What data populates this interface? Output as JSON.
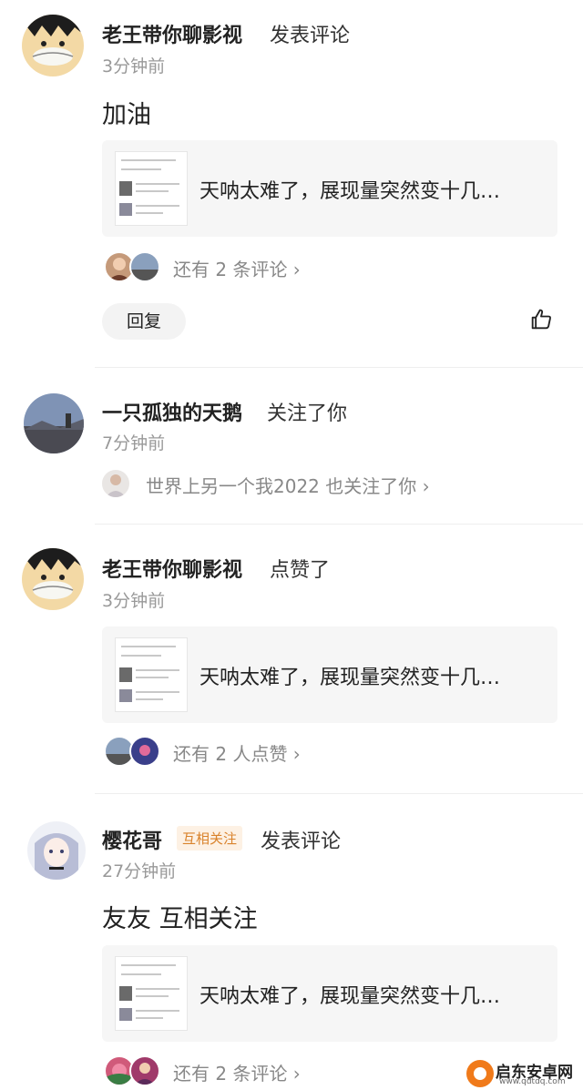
{
  "items": [
    {
      "user": "老王带你聊影视",
      "action": "发表评论",
      "time": "3分钟前",
      "content": "加油",
      "card_text": "天呐太难了，展现量突然变十几…",
      "more": "还有 2 条评论",
      "reply_label": "回复"
    },
    {
      "user": "一只孤独的天鹅",
      "action": "关注了你",
      "time": "7分钟前",
      "also_text": "世界上另一个我2022 也关注了你"
    },
    {
      "user": "老王带你聊影视",
      "action": "点赞了",
      "time": "3分钟前",
      "card_text": "天呐太难了，展现量突然变十几…",
      "more": "还有 2 人点赞"
    },
    {
      "user": "樱花哥",
      "badge": "互相关注",
      "action": "发表评论",
      "time": "27分钟前",
      "content": "友友 互相关注",
      "card_text": "天呐太难了，展现量突然变十几…",
      "more": "还有 2 条评论"
    }
  ],
  "icons": {
    "chevron": "chevron-right-icon",
    "like": "thumbs-up-icon"
  },
  "watermark": {
    "title": "启东安卓网",
    "url": "www.qdtdq.com"
  },
  "colors": {
    "badge_bg": "#fdf1e4",
    "badge_text": "#d9822b",
    "muted": "#999999"
  }
}
